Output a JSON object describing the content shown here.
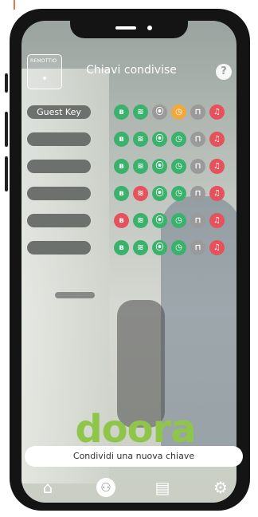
{
  "header": {
    "logo_text": "REMOTTIO",
    "title": "Chiavi condivise",
    "help_label": "?"
  },
  "colors": {
    "green": "#3ab26b",
    "red": "#e5525b",
    "orange": "#f0a93b",
    "gray": "#9a9a9a",
    "brand_green": "#8fc64a"
  },
  "keys": [
    {
      "name": "Guest Key",
      "icons": [
        {
          "type": "bluetooth-icon",
          "glyph": "ʙ",
          "color": "green"
        },
        {
          "type": "wifi-icon",
          "glyph": "≋",
          "color": "green"
        },
        {
          "type": "remote-signal-icon",
          "glyph": "⦿",
          "color": "gray"
        },
        {
          "type": "clock-icon",
          "glyph": "◷",
          "color": "orange"
        },
        {
          "type": "gate-icon",
          "glyph": "⊓",
          "color": "gray"
        },
        {
          "type": "alarm-bell-icon",
          "glyph": "♫",
          "color": "red"
        }
      ]
    },
    {
      "name": "",
      "icons": [
        {
          "type": "bluetooth-icon",
          "glyph": "ʙ",
          "color": "green"
        },
        {
          "type": "wifi-icon",
          "glyph": "≋",
          "color": "green"
        },
        {
          "type": "remote-signal-icon",
          "glyph": "⦿",
          "color": "green"
        },
        {
          "type": "clock-icon",
          "glyph": "◷",
          "color": "green"
        },
        {
          "type": "gate-icon",
          "glyph": "⊓",
          "color": "gray"
        },
        {
          "type": "alarm-bell-icon",
          "glyph": "♫",
          "color": "red"
        }
      ]
    },
    {
      "name": "",
      "icons": [
        {
          "type": "bluetooth-icon",
          "glyph": "ʙ",
          "color": "green"
        },
        {
          "type": "wifi-icon",
          "glyph": "≋",
          "color": "green"
        },
        {
          "type": "remote-signal-icon",
          "glyph": "⦿",
          "color": "green"
        },
        {
          "type": "clock-icon",
          "glyph": "◷",
          "color": "green"
        },
        {
          "type": "gate-icon",
          "glyph": "⊓",
          "color": "gray"
        },
        {
          "type": "alarm-bell-icon",
          "glyph": "♫",
          "color": "red"
        }
      ]
    },
    {
      "name": "",
      "icons": [
        {
          "type": "bluetooth-icon",
          "glyph": "ʙ",
          "color": "green"
        },
        {
          "type": "wifi-icon",
          "glyph": "≋",
          "color": "red"
        },
        {
          "type": "remote-signal-icon",
          "glyph": "⦿",
          "color": "green"
        },
        {
          "type": "clock-icon",
          "glyph": "◷",
          "color": "green"
        },
        {
          "type": "gate-icon",
          "glyph": "⊓",
          "color": "gray"
        },
        {
          "type": "alarm-bell-icon",
          "glyph": "♫",
          "color": "red"
        }
      ]
    },
    {
      "name": "",
      "icons": [
        {
          "type": "bluetooth-icon",
          "glyph": "ʙ",
          "color": "red"
        },
        {
          "type": "wifi-icon",
          "glyph": "≋",
          "color": "green"
        },
        {
          "type": "remote-signal-icon",
          "glyph": "⦿",
          "color": "green"
        },
        {
          "type": "clock-icon",
          "glyph": "◷",
          "color": "green"
        },
        {
          "type": "gate-icon",
          "glyph": "⊓",
          "color": "gray"
        },
        {
          "type": "alarm-bell-icon",
          "glyph": "♫",
          "color": "red"
        }
      ]
    },
    {
      "name": "",
      "icons": [
        {
          "type": "bluetooth-icon",
          "glyph": "ʙ",
          "color": "green"
        },
        {
          "type": "wifi-icon",
          "glyph": "≋",
          "color": "green"
        },
        {
          "type": "remote-signal-icon",
          "glyph": "⦿",
          "color": "green"
        },
        {
          "type": "clock-icon",
          "glyph": "◷",
          "color": "green"
        },
        {
          "type": "gate-icon",
          "glyph": "⊓",
          "color": "gray"
        },
        {
          "type": "alarm-bell-icon",
          "glyph": "♫",
          "color": "red"
        }
      ]
    }
  ],
  "brand": "doora",
  "share_button_label": "Condividi una nuova chiave",
  "nav": [
    {
      "name": "home-icon",
      "glyph": "⌂"
    },
    {
      "name": "share-keys-icon",
      "glyph": "⚇"
    },
    {
      "name": "document-icon",
      "glyph": "▤"
    },
    {
      "name": "settings-icon",
      "glyph": "⚙"
    }
  ]
}
